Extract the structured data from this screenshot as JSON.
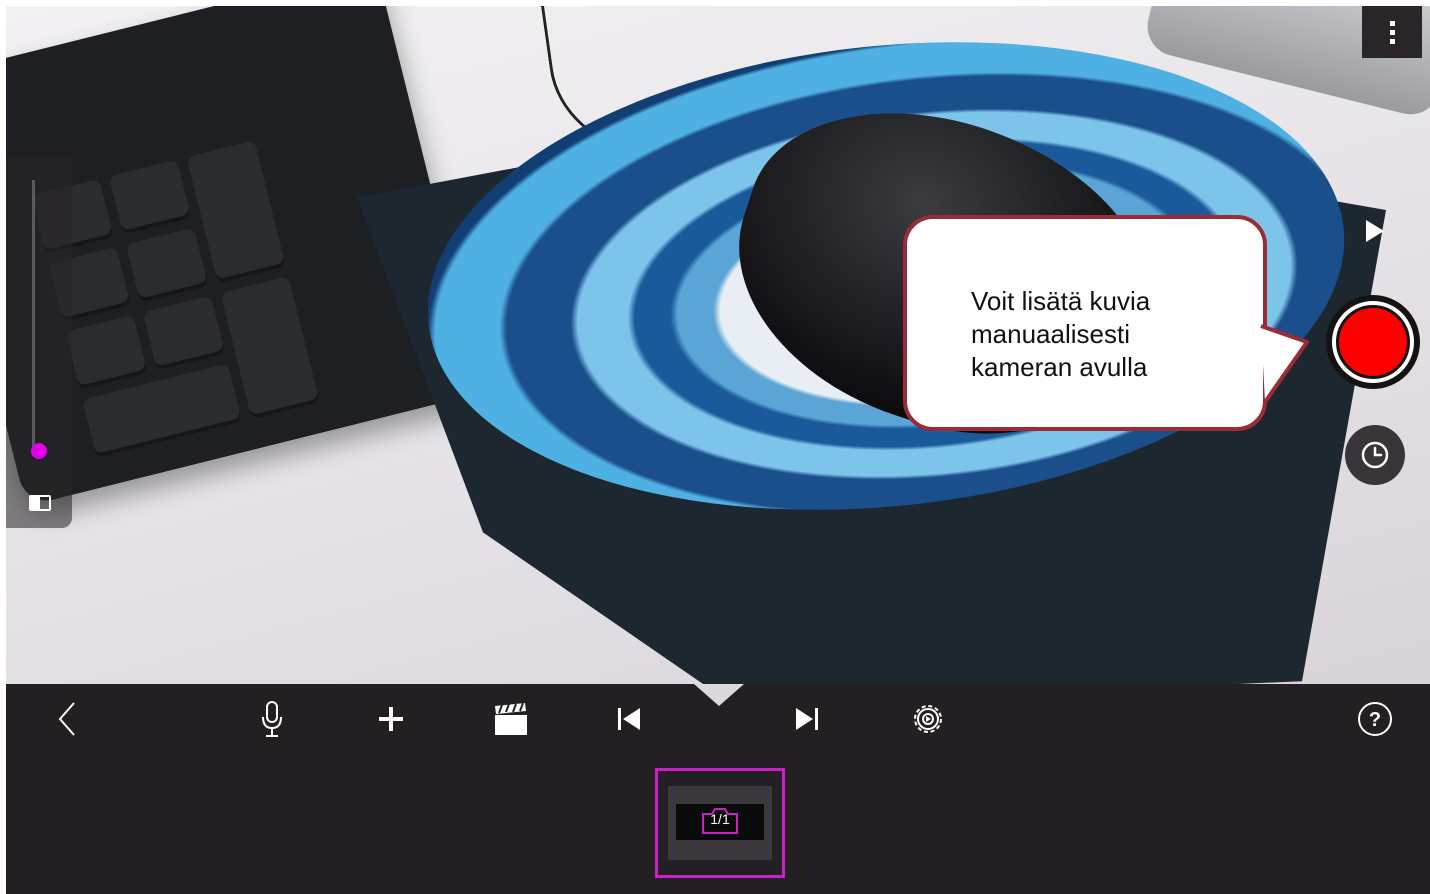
{
  "callout": {
    "lines": [
      "Voit lisätä kuvia",
      "manuaalisesti",
      "kameran avulla"
    ]
  },
  "left_panel": {
    "slider_level": 0.05
  },
  "right_controls": [
    "more-options",
    "play",
    "record",
    "timer"
  ],
  "toolbar": {
    "items": [
      "back",
      "microphone",
      "add",
      "clapperboard",
      "first-frame",
      "last-frame",
      "settings",
      "help"
    ],
    "help_label": "?"
  },
  "filmstrip": {
    "frame_counter": "1/1"
  },
  "colors": {
    "record": "#ff0000",
    "callout_border": "#9b2c35",
    "selection": "#c821c8",
    "slider_thumb": "#e000ee",
    "toolbar_bg": "#241f22"
  }
}
